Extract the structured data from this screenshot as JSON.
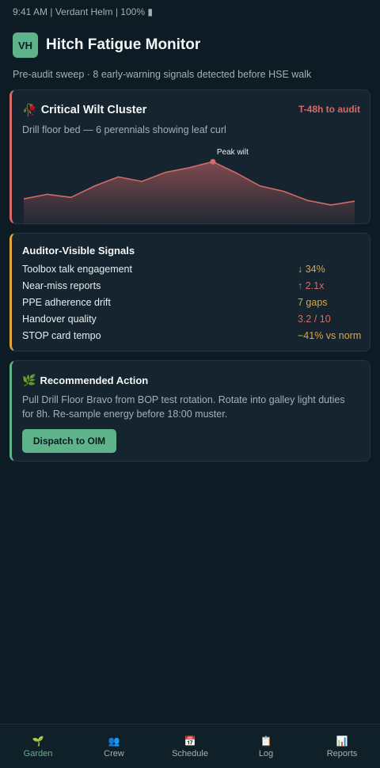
{
  "status_bar": {
    "text": "9:41 AM | Verdant Helm | 100% ▮"
  },
  "header": {
    "avatar": "VH",
    "title": "Hitch Fatigue Monitor",
    "subtitle": "Pre-audit sweep · 8 early-warning signals detected before HSE walk"
  },
  "alert_card": {
    "icon": "🥀",
    "title": "Critical Wilt Cluster",
    "badge": "T-48h to audit",
    "description": "Drill floor bed — 6 perennials showing leaf curl",
    "peak_label": "Peak wilt"
  },
  "chart_data": {
    "type": "area",
    "series": [
      {
        "values": [
          30,
          36,
          32,
          47,
          59,
          53,
          65,
          71,
          79,
          64,
          47,
          40,
          28,
          22,
          27
        ]
      }
    ],
    "peak_index": 8,
    "annotation": "Peak wilt",
    "ylim": [
      0,
      100
    ],
    "color": "#d46a6a"
  },
  "signals_card": {
    "title": "Auditor-Visible Signals",
    "items": [
      {
        "label": "Toolbox talk engagement",
        "value": "↓ 34%",
        "tone": "orange"
      },
      {
        "label": "Near-miss reports",
        "value": "↑ 2.1x",
        "tone": "red"
      },
      {
        "label": "PPE adherence drift",
        "value": "7 gaps",
        "tone": "orange"
      },
      {
        "label": "Handover quality",
        "value": "3.2 / 10",
        "tone": "red"
      },
      {
        "label": "STOP card tempo",
        "value": "−41% vs norm",
        "tone": "orange"
      }
    ]
  },
  "action_card": {
    "icon": "🌿",
    "title": "Recommended Action",
    "description": "Pull Drill Floor Bravo from BOP test rotation. Rotate into galley light duties for 8h. Re-sample energy before 18:00 muster.",
    "button_label": "Dispatch to OIM"
  },
  "nav": {
    "items": [
      {
        "icon": "🌱",
        "label": "Garden",
        "active": true
      },
      {
        "icon": "👥",
        "label": "Crew",
        "active": false
      },
      {
        "icon": "📅",
        "label": "Schedule",
        "active": false
      },
      {
        "icon": "📋",
        "label": "Log",
        "active": false
      },
      {
        "icon": "📊",
        "label": "Reports",
        "active": false
      }
    ]
  },
  "colors": {
    "background": "#0c1b24",
    "card": "#15242e",
    "accent_green": "#5fb38a",
    "accent_red": "#d46a6a",
    "accent_orange": "#e3a53a"
  }
}
